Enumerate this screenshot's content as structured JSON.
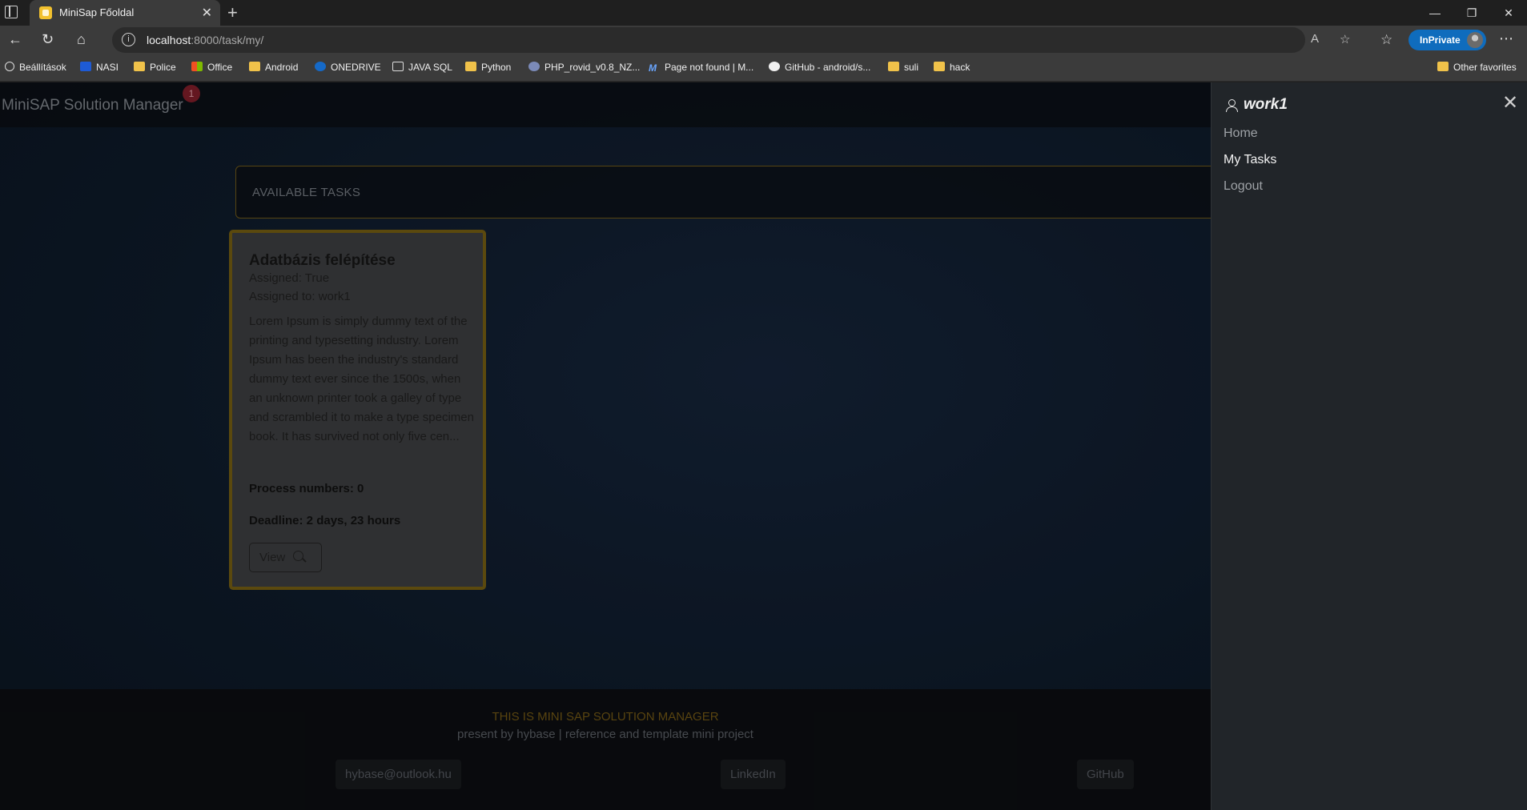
{
  "browser": {
    "tab_title": "MiniSap Főoldal",
    "url_host": "localhost",
    "url_rest": ":8000/task/my/",
    "inprivate_label": "InPrivate",
    "bookmarks": [
      "Beállítások",
      "NASI",
      "Police",
      "Office",
      "Android",
      "ONEDRIVE",
      "JAVA SQL",
      "Python",
      "PHP_rovid_v0.8_NZ...",
      "Page not found | M...",
      "GitHub - android/s...",
      "suli",
      "hack"
    ],
    "other_favorites": "Other favorites"
  },
  "navbar": {
    "brand": "MiniSAP Solution Manager",
    "badge": "1"
  },
  "section_title": "AVAILABLE TASKS",
  "task": {
    "title": "Adatbázis felépítése",
    "assigned": "Assigned: True",
    "assigned_to": "Assigned to: work1",
    "description": "Lorem Ipsum is simply dummy text of the printing and typesetting industry. Lorem Ipsum has been the industry's standard dummy text ever since the 1500s, when an unknown printer took a galley of type and scrambled it to make a type specimen book. It has survived not only five cen...",
    "process_numbers": "Process numbers: 0",
    "deadline": "Deadline: 2 days, 23 hours",
    "view_label": "View"
  },
  "footer": {
    "title": "THIS IS MINI SAP SOLUTION MANAGER",
    "subtitle": "present by hybase | reference and template mini project",
    "email": "hybase@outlook.hu",
    "linkedin": "LinkedIn",
    "github": "GitHub"
  },
  "offcanvas": {
    "username": "work1",
    "links": [
      "Home",
      "My Tasks",
      "Logout"
    ]
  }
}
